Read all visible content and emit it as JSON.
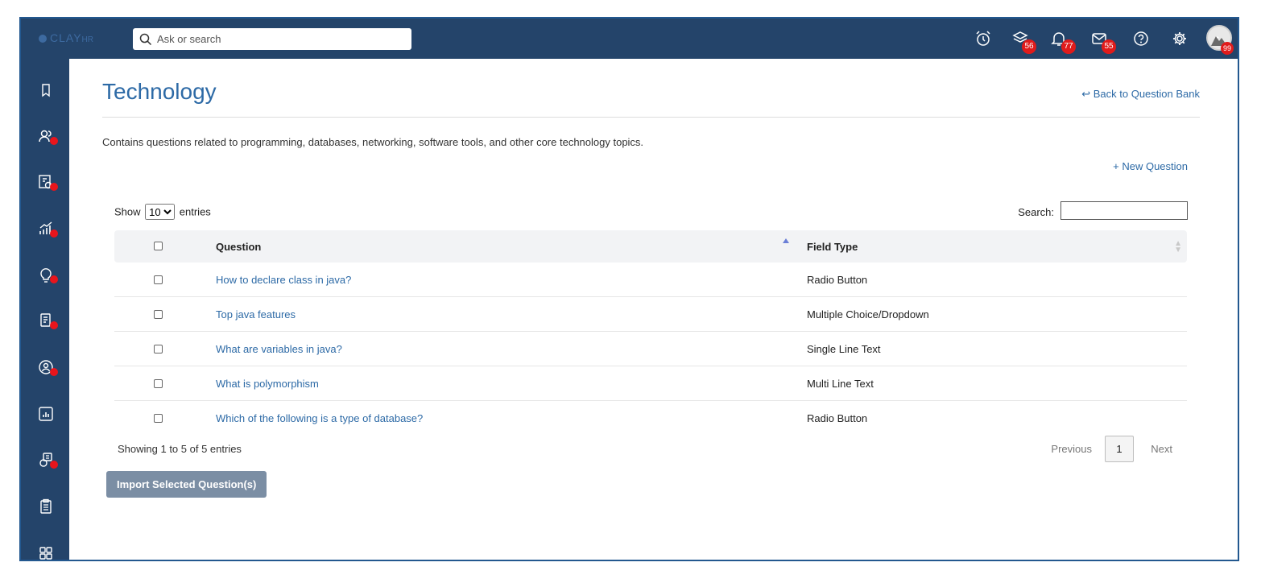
{
  "topbar": {
    "logo": "CLAY",
    "logo_suffix": "HR",
    "search_placeholder": "Ask or search",
    "badges": {
      "layers": "56",
      "notifications": "77",
      "messages": "55",
      "avatar": "99"
    },
    "icons": [
      "alarm-clock-icon",
      "layers-icon",
      "bell-icon",
      "mail-icon",
      "help-icon",
      "gear-icon",
      "avatar"
    ]
  },
  "sidebar": {
    "items": [
      "bookmark-icon",
      "users-icon",
      "payroll-icon",
      "growth-chart-icon",
      "idea-icon",
      "document-icon",
      "profile-icon",
      "report-icon",
      "helpdesk-icon",
      "clipboard-icon",
      "apps-icon"
    ]
  },
  "page": {
    "title": "Technology",
    "back_label": "Back to Question Bank",
    "description": "Contains questions related to programming, databases, networking, software tools, and other core technology topics.",
    "new_question_label": "+ New Question"
  },
  "table": {
    "show_label": "Show",
    "entries_label": "entries",
    "page_size": "10",
    "page_size_options": [
      "10"
    ],
    "search_label": "Search:",
    "columns": {
      "question": "Question",
      "field_type": "Field Type"
    },
    "rows": [
      {
        "question": "How to declare class in java?",
        "field_type": "Radio Button"
      },
      {
        "question": "Top java features",
        "field_type": "Multiple Choice/Dropdown"
      },
      {
        "question": "What are variables in java?",
        "field_type": "Single Line Text"
      },
      {
        "question": "What is polymorphism",
        "field_type": "Multi Line Text"
      },
      {
        "question": "Which of the following is a type of database?",
        "field_type": "Radio Button"
      }
    ],
    "info": "Showing 1 to 5 of 5 entries",
    "pagination": {
      "previous": "Previous",
      "current": "1",
      "next": "Next"
    }
  },
  "actions": {
    "import_label": "Import Selected Question(s)"
  },
  "colors": {
    "header_bg": "#24446a",
    "link": "#2d6aa6",
    "badge": "#e01b1b",
    "import_btn": "#7b8ea4"
  }
}
